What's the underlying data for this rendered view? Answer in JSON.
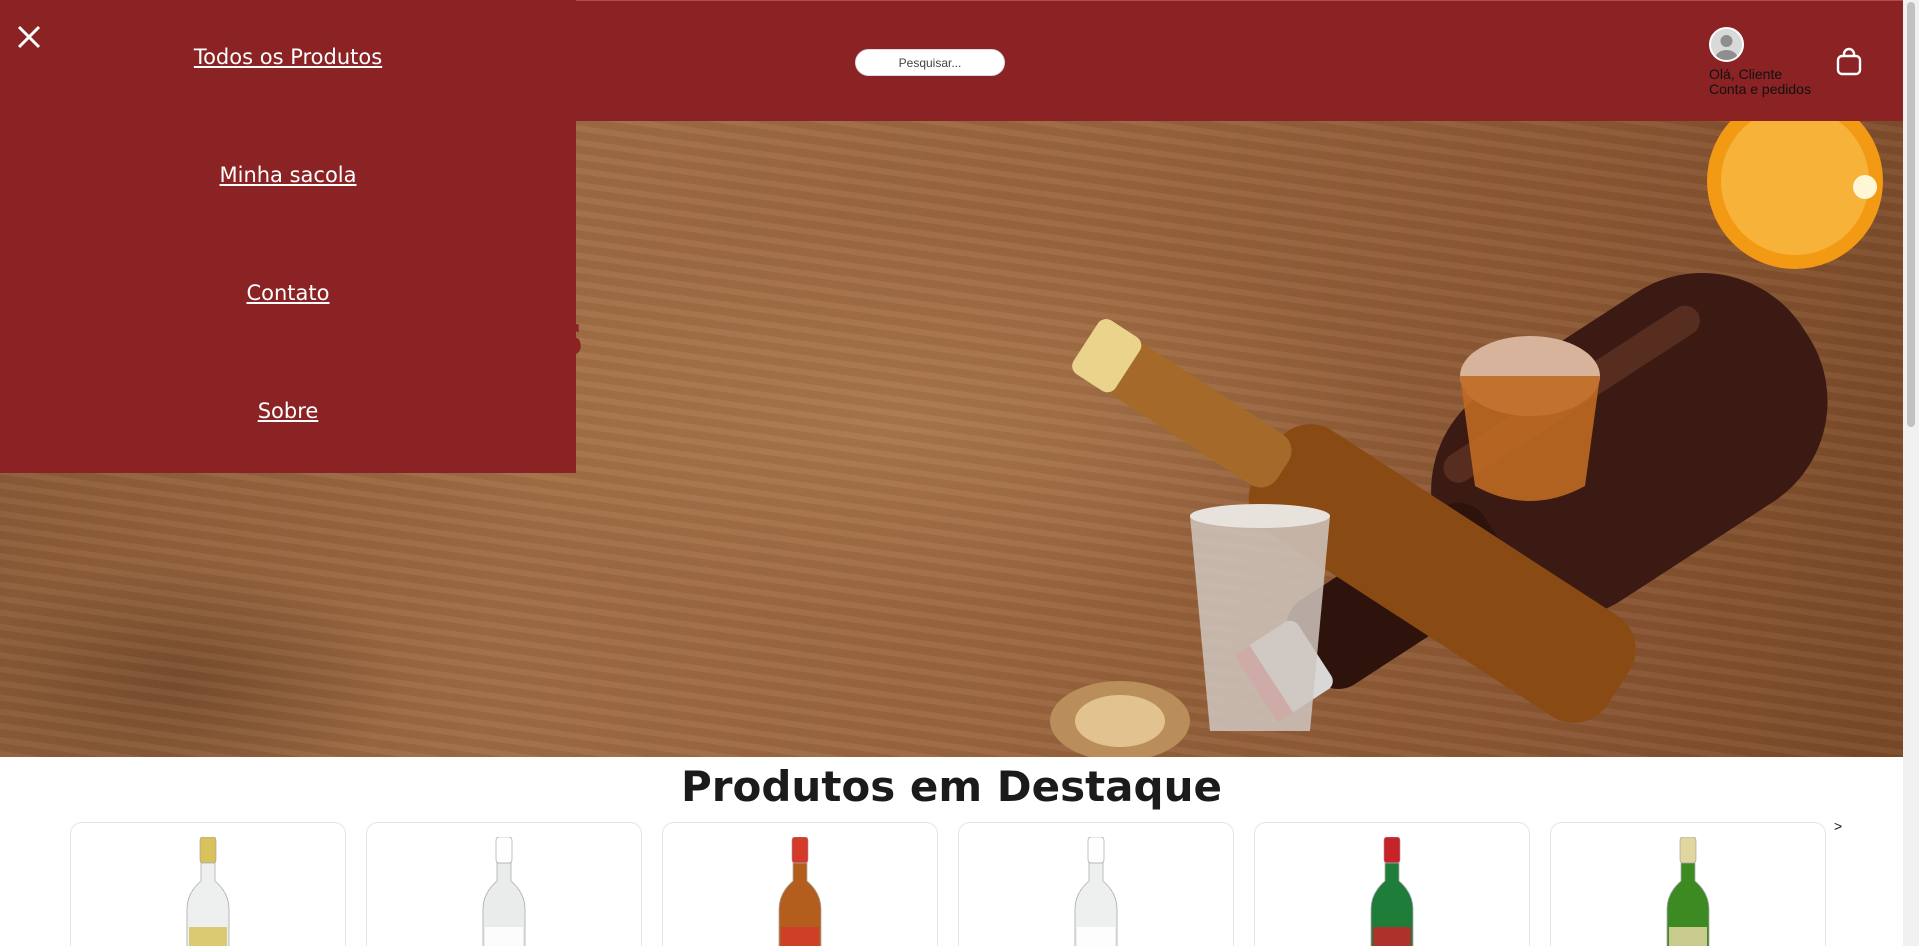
{
  "header": {
    "search_placeholder": "Pesquisar...",
    "account_greeting": "Olá, Cliente",
    "account_link": "Conta e pedidos",
    "brand_color": "#8b2224"
  },
  "menu": {
    "items": [
      {
        "label": "Todos os Produtos"
      },
      {
        "label": "Minha sacola"
      },
      {
        "label": "Contato"
      },
      {
        "label": "Sobre"
      }
    ]
  },
  "hero": {
    "visible_text": "vas"
  },
  "featured": {
    "title": "Produtos em Destaque",
    "next_label": ">",
    "products": [
      {
        "icon": "clear-bottle-gold-cap-icon",
        "label_color": "#d8c35a",
        "body_color": "#eef0f0"
      },
      {
        "icon": "clear-bottle-green-cap-icon",
        "label_color": "#ffffff",
        "body_color": "#e9ecea"
      },
      {
        "icon": "amber-bottle-red-cap-icon",
        "label_color": "#d43a2a",
        "body_color": "#b45e1d"
      },
      {
        "icon": "clear-bottle-tan-cap-icon",
        "label_color": "#ffffff",
        "body_color": "#eef0f0"
      },
      {
        "icon": "green-bottle-red-seal-icon",
        "label_color": "#c7242a",
        "body_color": "#1f7d3a"
      },
      {
        "icon": "green-bottle-gold-cap-icon",
        "label_color": "#e0d6a0",
        "body_color": "#3d8a23"
      }
    ]
  }
}
